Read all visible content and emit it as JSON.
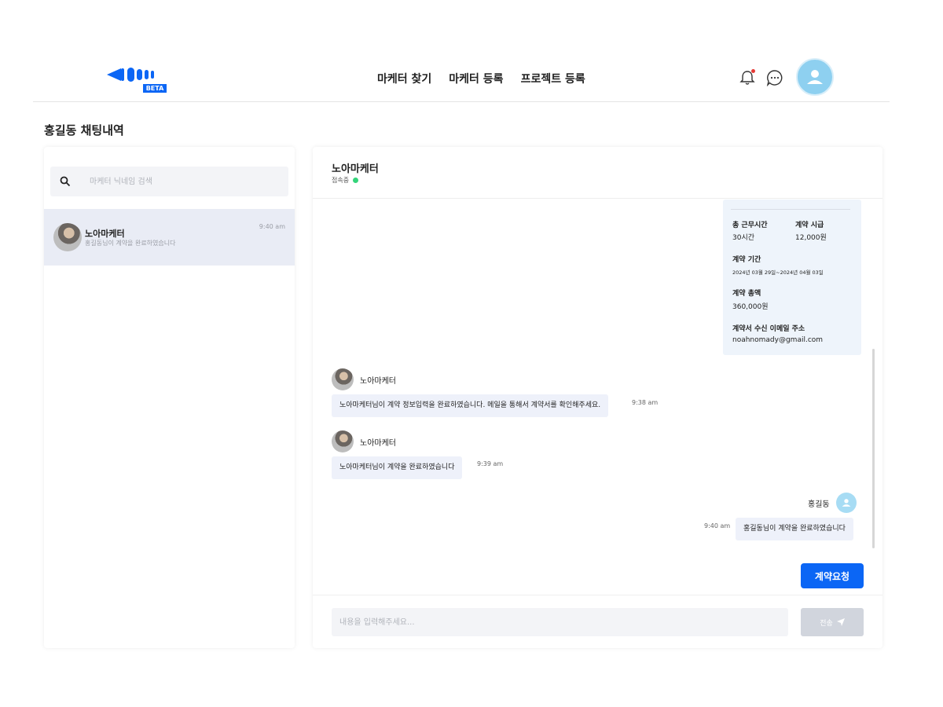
{
  "header": {
    "logo_badge": "BETA",
    "nav": [
      "마케터 찾기",
      "마케터 등록",
      "프로젝트 등록"
    ],
    "icons": [
      "bell-icon",
      "chat-bubble-icon",
      "user-avatar-icon"
    ],
    "accent_color": "#0b66f5"
  },
  "page": {
    "title": "홍길동 채팅내역"
  },
  "sidebar": {
    "search_placeholder": "마케터 닉네임 검색",
    "conversations": [
      {
        "name": "노아마케터",
        "preview": "홍길동님이 계약을 완료하였습니다",
        "time": "9:40 am"
      }
    ]
  },
  "chat": {
    "partner_name": "노아마케터",
    "status": "접속중",
    "contract_card": {
      "work_hours_label": "총 근무시간",
      "work_hours_value": "30시간",
      "hourly_rate_label": "계약 시급",
      "hourly_rate_value": "12,000원",
      "period_label": "계약 기간",
      "period_value": "2024년 03월 29일~2024년 04월 03일",
      "total_label": "계약 총액",
      "total_value": "360,000원",
      "email_label": "계약서 수신 이메일 주소",
      "email_value": "noahnomady@gmail.com"
    },
    "messages": [
      {
        "sender": "노아마케터",
        "text": "노아마케터님이 계약 정보입력을 완료하였습니다. 메일을 통해서 계약서를 확인해주세요.",
        "time": "9:38 am"
      },
      {
        "sender": "노아마케터",
        "text": "노아마케터님이 계약을 완료하였습니다",
        "time": "9:39 am"
      },
      {
        "sender": "홍길동",
        "text": "홍길동님이 계약을 완료하였습니다",
        "time": "9:40 am"
      }
    ],
    "request_button": "계약요청",
    "input_placeholder": "내용을 입력해주세요...",
    "send_button": "전송"
  }
}
